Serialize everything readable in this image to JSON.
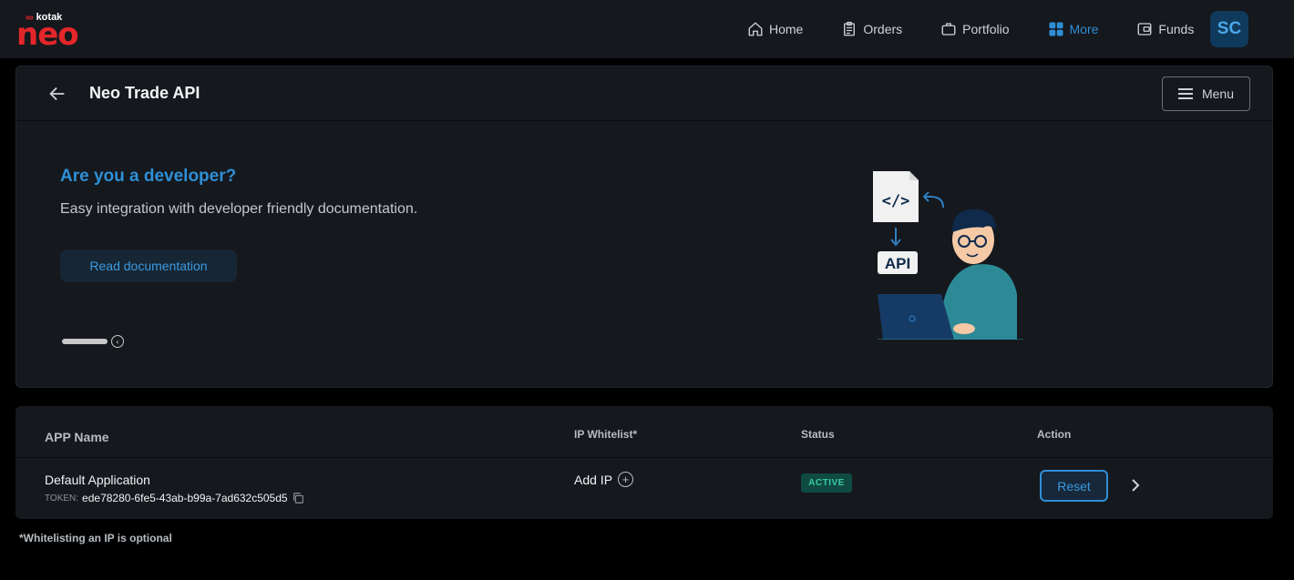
{
  "brand": {
    "kotak": "kotak",
    "neo": "neo"
  },
  "nav": {
    "items": [
      {
        "label": "Home",
        "icon": "home-icon"
      },
      {
        "label": "Orders",
        "icon": "clipboard-icon"
      },
      {
        "label": "Portfolio",
        "icon": "briefcase-icon"
      },
      {
        "label": "More",
        "icon": "grid-icon",
        "active": true
      },
      {
        "label": "Funds",
        "icon": "wallet-icon"
      }
    ],
    "avatar": "SC"
  },
  "header": {
    "title": "Neo Trade API",
    "menu_label": "Menu"
  },
  "promo": {
    "title": "Are you a developer?",
    "subtitle": "Easy integration with developer friendly documentation.",
    "button": "Read documentation",
    "illustration": {
      "code_label": "</>",
      "api_label": "API"
    }
  },
  "table": {
    "headers": {
      "app": "APP Name",
      "ip": "IP Whitelist*",
      "status": "Status",
      "action": "Action"
    },
    "rows": [
      {
        "app_name": "Default Application",
        "token_label": "TOKEN:",
        "token": "ede78280-6fe5-43ab-b99a-7ad632c505d5",
        "ip_action": "Add IP",
        "status": "ACTIVE",
        "action": "Reset"
      }
    ]
  },
  "footnote": "*Whitelisting an IP is optional",
  "colors": {
    "accent": "#2f8fd6",
    "brand": "#e3262a",
    "active_badge": "#3ac9a4"
  }
}
